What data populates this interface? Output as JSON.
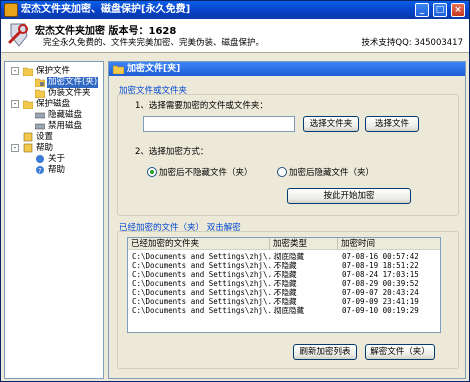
{
  "window": {
    "title": "宏杰文件夹加密、磁盘保护[永久免费]",
    "buttons": {
      "minimize": "_",
      "maximize": "□",
      "close": "×"
    }
  },
  "header": {
    "title": "宏杰文件夹加密  版本号：1628",
    "subtitle": "完全永久免费的、文件夹完美加密、完美伪装、磁盘保护。",
    "support": "技术支持QQ: 345003417"
  },
  "tree": {
    "nodes": [
      {
        "label": "保护文件",
        "expander": "-"
      },
      {
        "label": "加密文件(夹)",
        "selected": true
      },
      {
        "label": "伪装文件夹"
      },
      {
        "label": "保护磁盘",
        "expander": "-"
      },
      {
        "label": "隐藏磁盘"
      },
      {
        "label": "禁用磁盘"
      },
      {
        "label": "设置"
      },
      {
        "label": "帮助",
        "expander": "-"
      },
      {
        "label": "关于"
      },
      {
        "label": "帮助"
      }
    ]
  },
  "main": {
    "title": "加密文件[夹]",
    "section_encrypt": "加密文件或文件夹",
    "step1": "1、选择需要加密的文件或文件夹：",
    "path_value": "",
    "btn_select_folder": "选择文件夹",
    "btn_select_file": "选择文件",
    "step2": "2、选择加密方式：",
    "radio_after_hide": "加密后不隐藏文件（夹）",
    "radio_after_hide_checked": true,
    "radio_hide": "加密后隐藏文件（夹）",
    "btn_start": "按此开始加密",
    "section_list": "已经加密的文件（夹）  双击解密",
    "table": {
      "headers": [
        "已经加密的文件夹",
        "加密类型",
        "加密时间"
      ],
      "rows": [
        [
          "C:\\Documents and Settings\\zhj\\...",
          "彻底隐藏",
          "07-08-16 00:57:42"
        ],
        [
          "C:\\Documents and Settings\\zhj\\...",
          "不隐藏",
          "07-08-19 18:51:22"
        ],
        [
          "C:\\Documents and Settings\\zhj\\...",
          "不隐藏",
          "07-08-24 17:03:15"
        ],
        [
          "C:\\Documents and Settings\\zhj\\...",
          "不隐藏",
          "07-08-29 00:39:52"
        ],
        [
          "C:\\Documents and Settings\\zhj\\...",
          "不隐藏",
          "07-09-07 20:43:24"
        ],
        [
          "C:\\Documents and Settings\\zhj\\...",
          "不隐藏",
          "07-09-09 23:41:19"
        ],
        [
          "C:\\Documents and Settings\\zhj\\...",
          "彻底隐藏",
          "07-09-10 00:19:29"
        ]
      ]
    },
    "btn_refresh": "刷新加密列表",
    "btn_decrypt": "解密文件（夹）"
  }
}
